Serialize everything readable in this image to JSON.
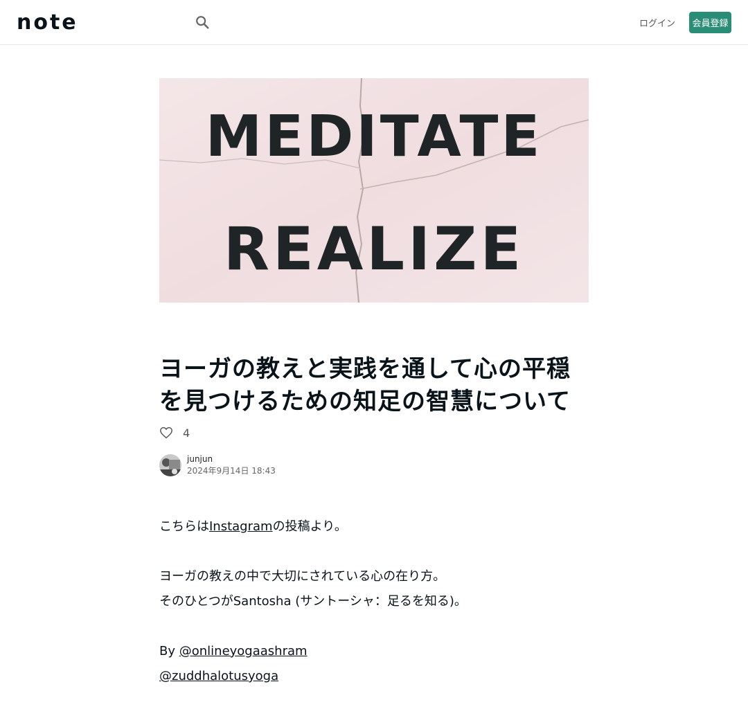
{
  "header": {
    "logo_text": "note",
    "search_icon": "search-icon",
    "login_label": "ログイン",
    "signup_label": "会員登録",
    "brand_color": "#2a8d76"
  },
  "hero_image": {
    "line1": "MEDITATE",
    "line2": "REALIZE"
  },
  "article": {
    "title": "ヨーガの教えと実践を通して心の平穏を見つけるための知足の智慧について",
    "like_icon": "heart-icon",
    "like_count": "4",
    "author_name": "junjun",
    "date": "2024年9月14日 18:43",
    "body": {
      "intro_before": "こちらは",
      "intro_link": "Instagram",
      "intro_after": "の投稿より。",
      "line2": "ヨーガの教えの中で大切にされている心の在り方。",
      "line3": "そのひとつがSantosha (サントーシャ：足るを知る)。",
      "by_label": "By ",
      "link1": "@onlineyogaashram",
      "link2": "@zuddhalotusyoga"
    }
  }
}
